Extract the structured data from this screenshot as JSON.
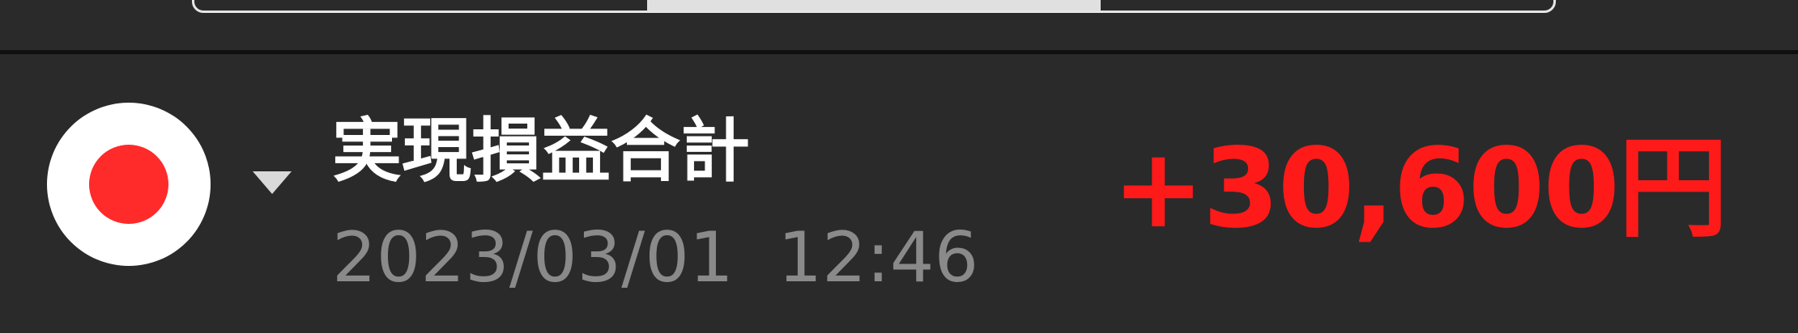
{
  "segmented_control": {
    "selected_index": 1,
    "segment_count": 3
  },
  "summary_row": {
    "label": "実現損益合計",
    "timestamp": "2023/03/01  12:46",
    "amount": "+30,600円",
    "status_color": "#ff2a2a",
    "amount_color": "#ff1a1a",
    "dropdown_icon": "caret-down-icon"
  }
}
